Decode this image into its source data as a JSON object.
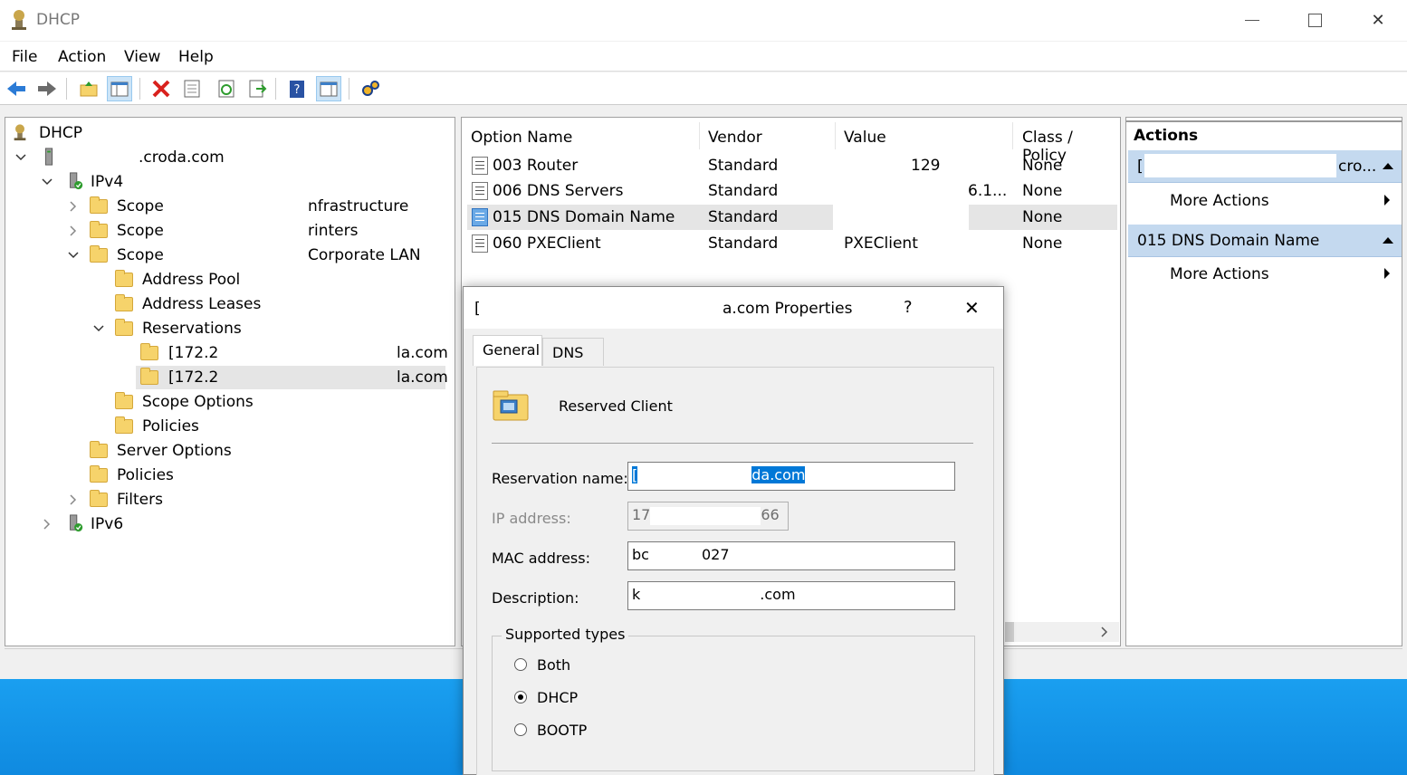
{
  "window": {
    "title": "DHCP",
    "minimize": "—",
    "maximize": "□",
    "close": "✕"
  },
  "menu": [
    "File",
    "Action",
    "View",
    "Help"
  ],
  "tree": {
    "root": "DHCP",
    "server": ".croda.com",
    "ipv4": "IPv4",
    "scope1": "Scope",
    "scope1_desc": "nfrastructure",
    "scope2": "Scope",
    "scope2_desc": "rinters",
    "scope3": "Scope",
    "scope3_desc": "Corporate LAN",
    "address_pool": "Address Pool",
    "address_leases": "Address Leases",
    "reservations": "Reservations",
    "res1": "[172.2",
    "res1_suffix": "la.com",
    "res2": "[172.2",
    "res2_suffix": "la.com",
    "scope_options": "Scope Options",
    "policies_scope": "Policies",
    "server_options": "Server Options",
    "policies": "Policies",
    "filters": "Filters",
    "ipv6": "IPv6"
  },
  "list": {
    "headers": [
      "Option Name",
      "Vendor",
      "Value",
      "Class / Policy"
    ],
    "rows": [
      {
        "name": "003 Router",
        "vendor": "Standard",
        "value": "129",
        "policy": "None"
      },
      {
        "name": "006 DNS Servers",
        "vendor": "Standard",
        "value": "6.1...",
        "policy": "None"
      },
      {
        "name": "015 DNS Domain Name",
        "vendor": "Standard",
        "value": "",
        "policy": "None"
      },
      {
        "name": "060 PXEClient",
        "vendor": "Standard",
        "value": "PXEClient",
        "policy": "None"
      }
    ]
  },
  "actions": {
    "title": "Actions",
    "group1": "[",
    "group1_suffix": "cro...",
    "more_actions_1": "More Actions",
    "group2": "015 DNS Domain Name",
    "more_actions_2": "More Actions"
  },
  "dialog": {
    "title_prefix": "[",
    "title": "a.com Properties",
    "help": "?",
    "close": "✕",
    "tab_general": "General",
    "tab_dns": "DNS",
    "heading": "Reserved Client",
    "reservation_name_label": "Reservation name:",
    "reservation_name_prefix": "[",
    "reservation_name_value": "da.com",
    "ip_label": "IP address:",
    "ip_prefix": "17",
    "ip_suffix": "66",
    "mac_label": "MAC address:",
    "mac_prefix": "bc",
    "mac_suffix": "027",
    "desc_label": "Description:",
    "desc_prefix": "k",
    "desc_suffix": ".com",
    "supported_types": "Supported types",
    "opt_both": "Both",
    "opt_dhcp": "DHCP",
    "opt_bootp": "BOOTP",
    "selected_type": "DHCP"
  }
}
